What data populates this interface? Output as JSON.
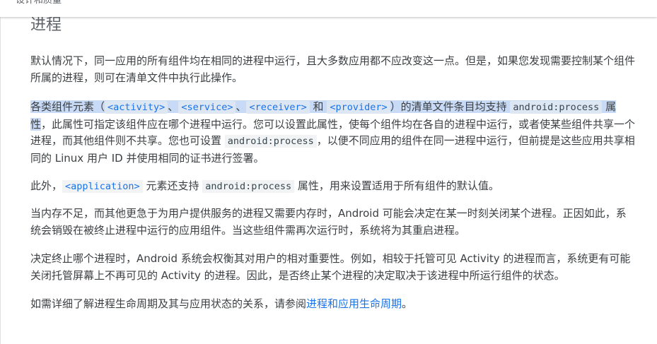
{
  "topbar": {
    "breadcrumb": "设计和质量"
  },
  "section": {
    "title": "进程"
  },
  "p1": {
    "text": "默认情况下，同一应用的所有组件均在相同的进程中运行，且大多数应用都不应改变这一点。但是，如果您发现需要控制某个组件所属的进程，则可在清单文件中执行此操作。"
  },
  "p2": {
    "t1": "各类组件元素（",
    "tag_activity": "<activity>",
    "sep1": "、",
    "tag_service": "<service>",
    "sep2": "、",
    "tag_receiver": "<receiver>",
    "sep3": " 和 ",
    "tag_provider": "<provider>",
    "t2": "）的清单文件条目均支持 ",
    "attr": "android:process",
    "t3": " 属性",
    "t4": "，此属性可指定该组件应在哪个进程中运行。您可以设置此属性，使每个组件均在各自的进程中运行，或者使某些组件共享一个进程，而其他组件则不共享。您也可设置 ",
    "attr2": "android:process",
    "t5": "，以便不同应用的组件在同一进程中运行，但前提是这些应用共享相同的 Linux 用户 ID 并使用相同的证书进行签署。"
  },
  "p3": {
    "t1": "此外，",
    "tag_application": "<application>",
    "t2": " 元素还支持 ",
    "attr": "android:process",
    "t3": " 属性，用来设置适用于所有组件的默认值。"
  },
  "p4": {
    "text": "当内存不足，而其他更急于为用户提供服务的进程又需要内存时，Android 可能会决定在某一时刻关闭某个进程。正因如此，系统会销毁在被终止进程中运行的应用组件。当这些组件需再次运行时，系统将为其重启进程。"
  },
  "p5": {
    "text": "决定终止哪个进程时，Android 系统会权衡其对用户的相对重要性。例如，相较于托管可见 Activity 的进程而言，系统更有可能关闭托管屏幕上不再可见的 Activity 的进程。因此，是否终止某个进程的决定取决于该进程中所运行组件的状态。"
  },
  "p6": {
    "t1": "如需详细了解进程生命周期及其与应用状态的关系，请参阅",
    "link": "进程和应用生命周期",
    "t2": "。"
  },
  "colors": {
    "link": "#1a73e8",
    "selection": "#c8daf5",
    "code_bg": "#f1f3f4"
  }
}
